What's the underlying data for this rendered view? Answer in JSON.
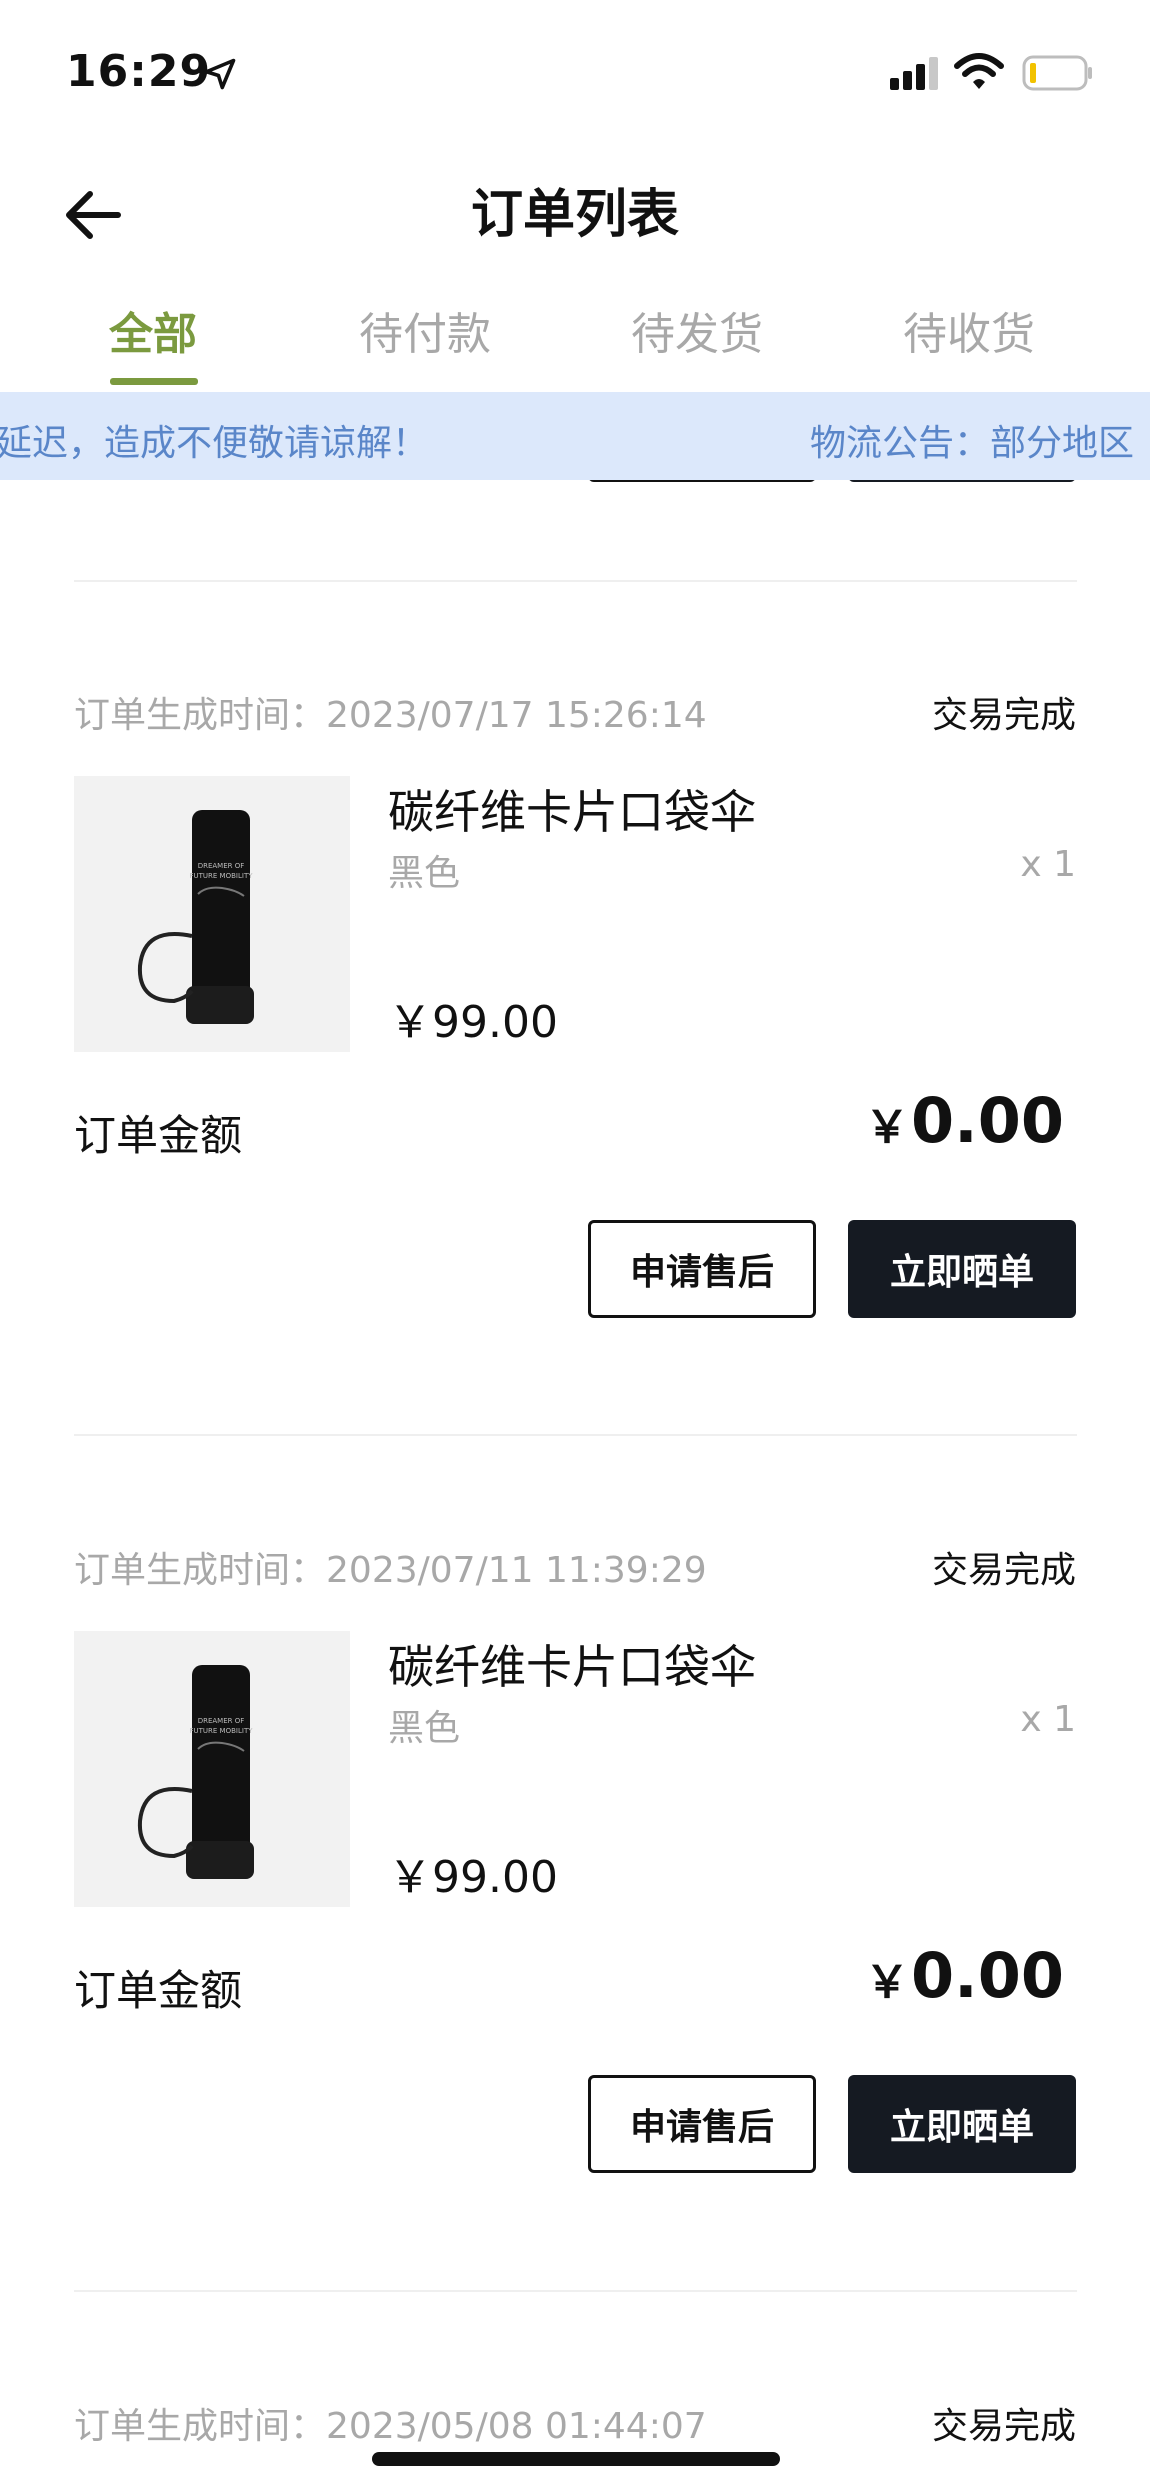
{
  "status_bar": {
    "time": "16:29",
    "icons": [
      "location-arrow-icon",
      "cellular-signal-icon",
      "wifi-icon",
      "battery-icon"
    ]
  },
  "nav": {
    "back_icon": "arrow-left-icon",
    "title": "订单列表"
  },
  "tabs": [
    {
      "label": "全部",
      "active": true
    },
    {
      "label": "待付款",
      "active": false
    },
    {
      "label": "待发货",
      "active": false
    },
    {
      "label": "待收货",
      "active": false
    }
  ],
  "notice": {
    "text_tail": "延迟，造成不便敬请谅解！",
    "text_head": "物流公告：部分地区"
  },
  "orders": [
    {
      "time_label": "订单生成时间：",
      "time": "2023/07/17 15:26:14",
      "status": "交易完成",
      "product": {
        "name": "碳纤维卡片口袋伞",
        "variant": "黑色",
        "qty": "x 1",
        "price": "￥99.00"
      },
      "amount_label": "订单金额",
      "amount_currency": "￥",
      "amount": "0.00",
      "buttons": {
        "after_sale": "申请售后",
        "review": "立即晒单"
      }
    },
    {
      "time_label": "订单生成时间：",
      "time": "2023/07/11 11:39:29",
      "status": "交易完成",
      "product": {
        "name": "碳纤维卡片口袋伞",
        "variant": "黑色",
        "qty": "x 1",
        "price": "￥99.00"
      },
      "amount_label": "订单金额",
      "amount_currency": "￥",
      "amount": "0.00",
      "buttons": {
        "after_sale": "申请售后",
        "review": "立即晒单"
      }
    },
    {
      "time_label": "订单生成时间：",
      "time": "2023/05/08 01:44:07",
      "status": "交易完成"
    }
  ],
  "colors": {
    "accent": "#7b9a3f",
    "notice_bg": "#dce8fb",
    "notice_text": "#5a86c9",
    "muted": "#a8a8a8",
    "button_dark": "#151a22"
  }
}
